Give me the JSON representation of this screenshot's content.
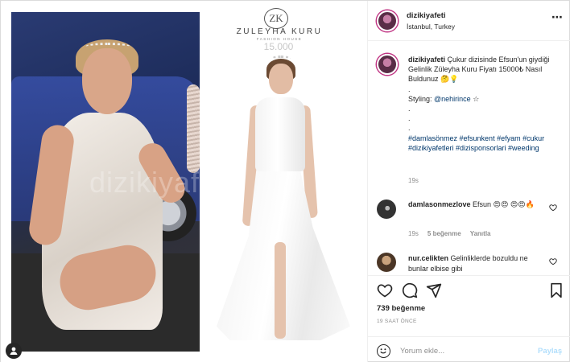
{
  "media": {
    "watermark": "dizikiyafeti",
    "brand_initials": "ZK",
    "brand_name": "ZULEYHA KURU",
    "brand_tagline": "FASHION HOUSE",
    "price": "15.000"
  },
  "header": {
    "username": "dizikiyafeti",
    "location": "İstanbul, Turkey",
    "more_icon": "⋯"
  },
  "caption": {
    "username": "dizikiyafeti",
    "text": "Çukur dizisinde Efsun'un giydiği Gelinlik Züleyha Kuru Fiyatı 15000₺ Nasıl Buldunuz 🤔💡",
    "styling_label": "Styling:",
    "styling_mention": "@nehirince",
    "styling_suffix": "☆",
    "dot1": ".",
    "dot2": ".",
    "dot3": ".",
    "dot4": ".",
    "hashtags": "#damlasönmez #efsunkent #efyam #cukur #dizikiyafetleri #dizisponsorlari #weeding",
    "time": "19s"
  },
  "comments": [
    {
      "username": "damlasonmezlove",
      "text": "Efsun 😍😍 😍😍🔥",
      "time": "19s",
      "likes": "5 beğenme",
      "reply": "Yanıtla"
    },
    {
      "username": "nur.celikten",
      "text": "Gelinliklerde bozuldu ne bunlar elbise gibi"
    }
  ],
  "actions": {
    "likes": "739 beğenme",
    "ago": "19 SAAT ÖNCE",
    "comment_placeholder": "Yorum ekle...",
    "share_label": "Paylaş"
  },
  "colors": {
    "link": "#00376b",
    "muted": "#8e8e8e",
    "share_disabled": "#b2dffc"
  }
}
